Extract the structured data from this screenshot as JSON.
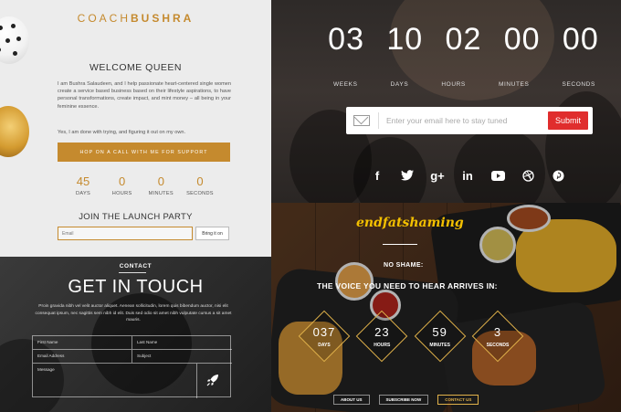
{
  "coach": {
    "logo_a": "COACH",
    "logo_b": "BUSHRA",
    "welcome": "WELCOME QUEEN",
    "intro": "I am Bushra Salaudeen, and I help passionate heart-centered single women create a service based business based on their lifestyle aspirations, to have personal transformations, create impact, and mint money – all being in your feminine essence.",
    "done_line": "Yes, I am done with trying, and figuring it out on my own.",
    "cta": "HOP ON A CALL WITH ME FOR SUPPORT",
    "countdown": [
      {
        "value": "45",
        "label": "DAYS"
      },
      {
        "value": "0",
        "label": "HOURS"
      },
      {
        "value": "0",
        "label": "MINUTES"
      },
      {
        "value": "0",
        "label": "SECONDS"
      }
    ],
    "join_title": "JOIN THE LAUNCH PARTY",
    "email_placeholder": "Email",
    "bring_button": "Bring it on"
  },
  "launch": {
    "digits": [
      "03",
      "10",
      "02",
      "00",
      "00"
    ],
    "labels": [
      "WEEKS",
      "DAYS",
      "HOURS",
      "MINUTES",
      "SECONDS"
    ],
    "email_placeholder": "Enter your email here to stay tuned",
    "submit": "Submit",
    "social": [
      {
        "icon": "facebook-icon",
        "glyph": "f"
      },
      {
        "icon": "twitter-icon",
        "glyph": "t"
      },
      {
        "icon": "google-plus-icon",
        "glyph": "g+"
      },
      {
        "icon": "linkedin-icon",
        "glyph": "in"
      },
      {
        "icon": "youtube-icon",
        "glyph": "▶"
      },
      {
        "icon": "dribbble-icon",
        "glyph": "◍"
      },
      {
        "icon": "pinterest-icon",
        "glyph": "P"
      }
    ]
  },
  "contact": {
    "tag": "CONTACT",
    "title": "GET IN TOUCH",
    "desc": "Proin gravida nibh vel velit auctor aliquet. Aenean sollicitudin, lorem quis bibendum auctor, nisi elit consequat ipsum, nec sagittis sem nibh id elit. Duis sed odio sit amet nibh vulputate cursus a sit amet mauris.",
    "first_name": "First Name",
    "last_name": "Last Name",
    "email": "Email Address",
    "subject": "Subject",
    "message": "Message"
  },
  "efs": {
    "brand": "endfatshaming",
    "noshame": "NO SHAME:",
    "voice": "THE VOICE YOU NEED TO HEAR ARRIVES IN:",
    "countdown": [
      {
        "value": "037",
        "label": "DAYS"
      },
      {
        "value": "23",
        "label": "HOURS"
      },
      {
        "value": "59",
        "label": "MINUTES"
      },
      {
        "value": "3",
        "label": "SECONDS"
      }
    ],
    "buttons": [
      "ABOUT US",
      "SUBSCRIBE NOW",
      "CONTACT US"
    ]
  },
  "colors": {
    "gold": "#c58a2e",
    "submit_red": "#e02d2d",
    "brand_yellow": "#f3c000"
  }
}
